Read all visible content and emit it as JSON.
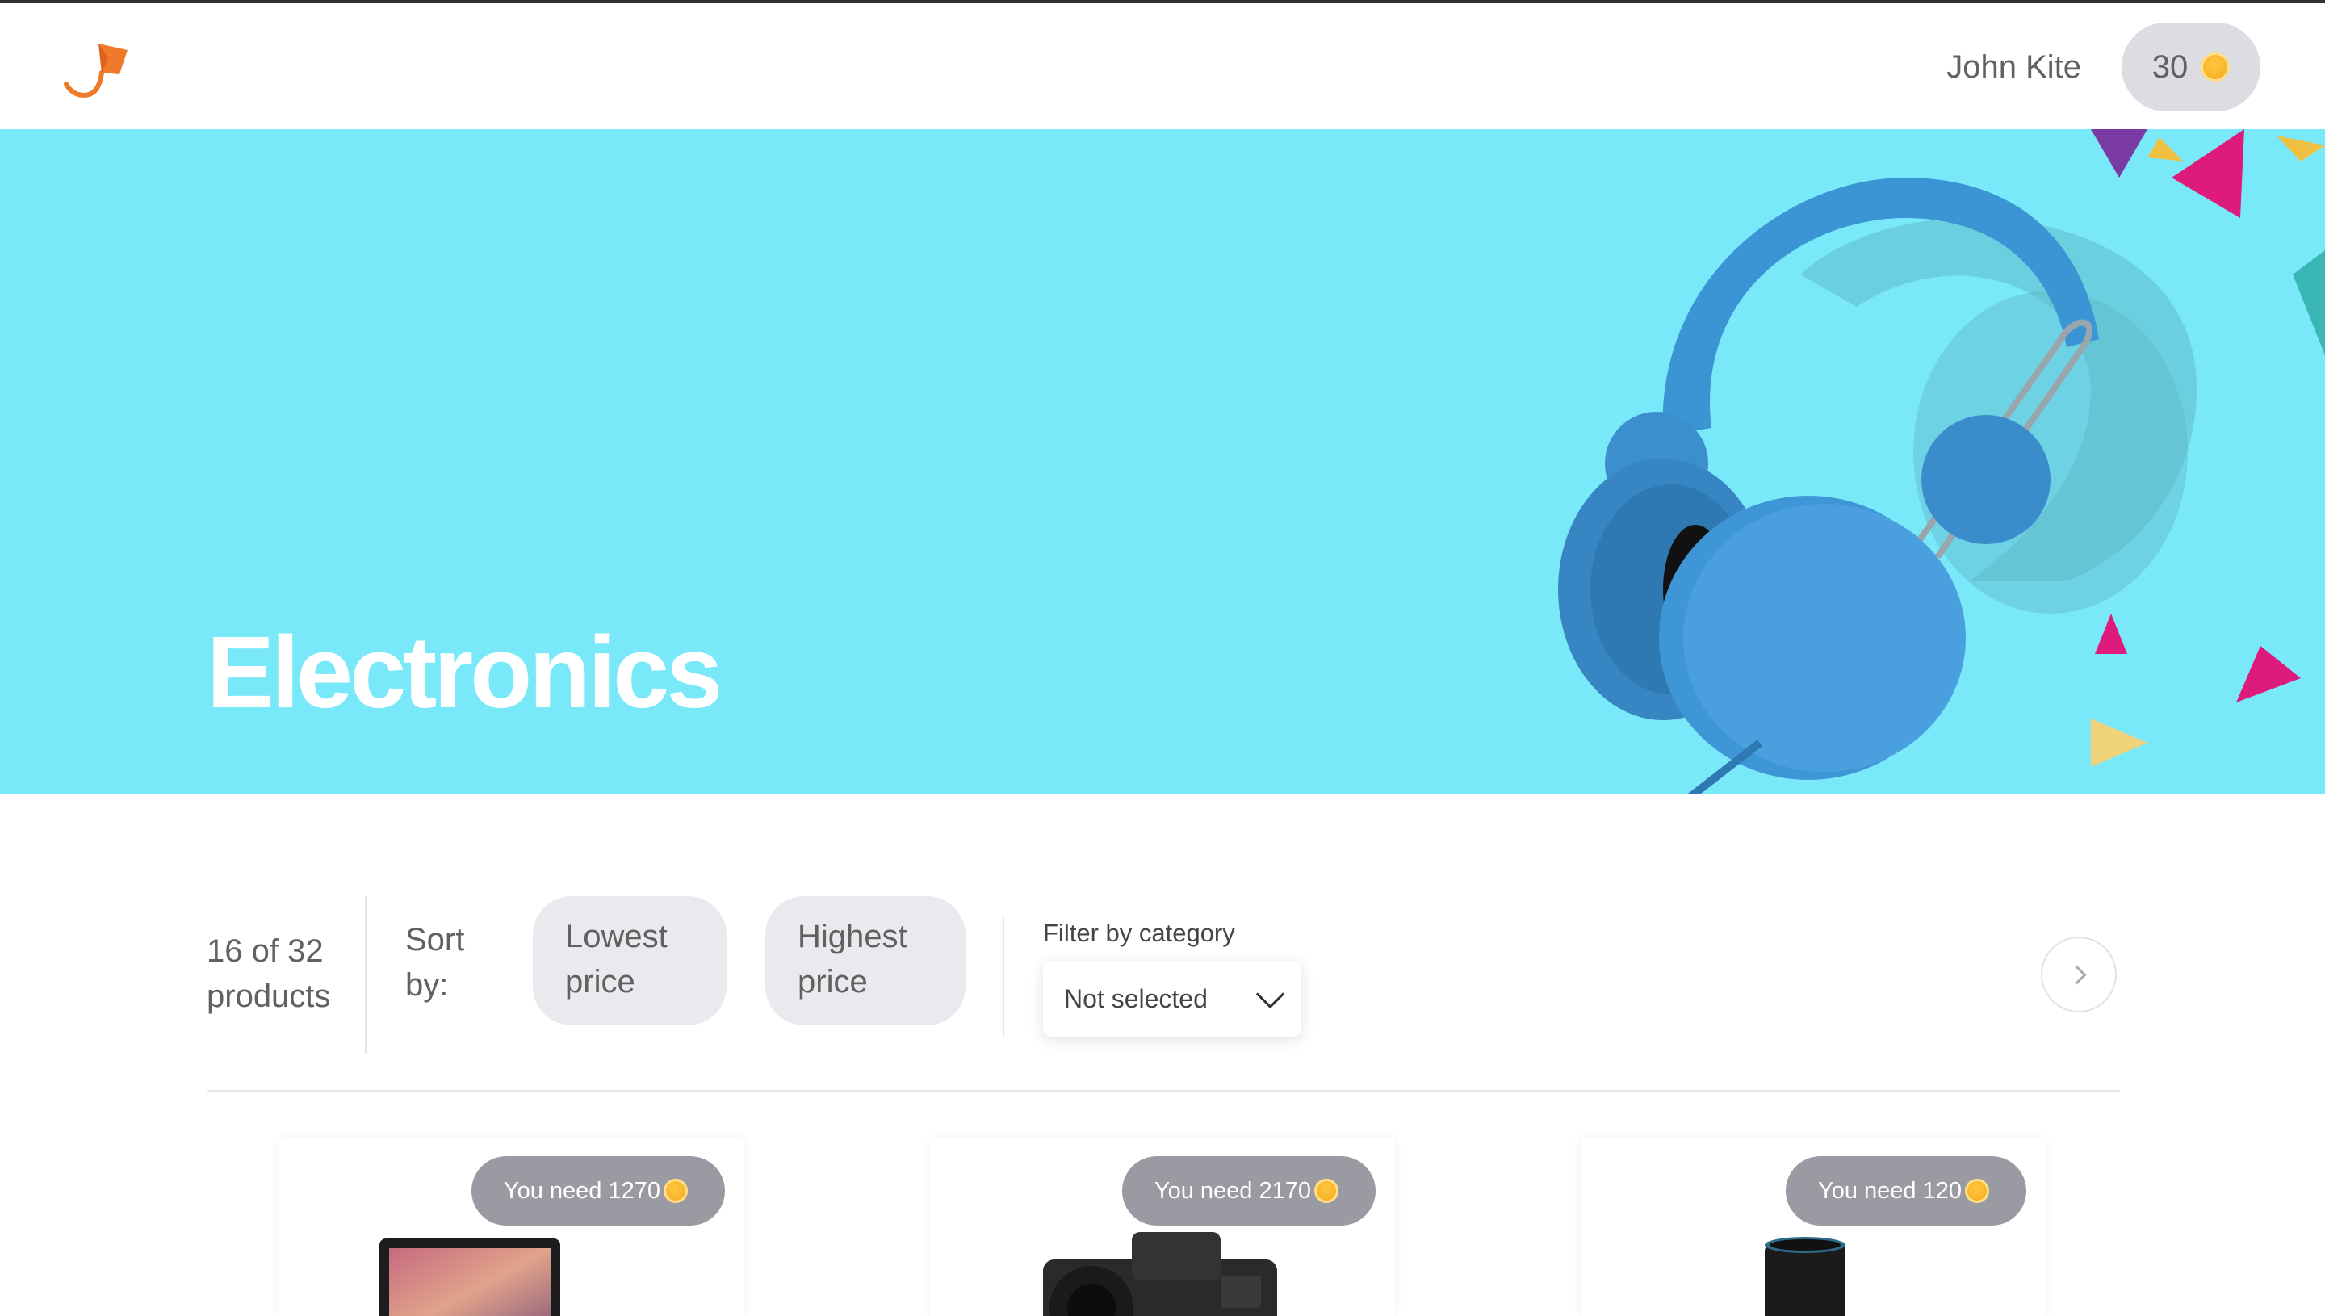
{
  "header": {
    "user_name": "John Kite",
    "points": "30",
    "logo_icon": "kite-logo-icon",
    "coin_icon": "coin-icon"
  },
  "banner": {
    "title": "Electronics",
    "background_color": "#79e9fa",
    "image": "headphones-image"
  },
  "toolbar": {
    "count_text": "16 of 32 products",
    "sort_label": "Sort by:",
    "sort_options": [
      {
        "label": "Lowest price"
      },
      {
        "label": "Highest price"
      }
    ],
    "filter_label": "Filter by category",
    "filter_value": "Not selected",
    "next_icon": "chevron-right-icon"
  },
  "products": [
    {
      "need_text": "You need 1270",
      "image": "laptop-image"
    },
    {
      "need_text": "You need 2170",
      "image": "camera-image"
    },
    {
      "need_text": "You need 120",
      "image": "smart-speaker-image"
    }
  ],
  "colors": {
    "accent": "#f07a2c",
    "coin": "#f7b52b",
    "pill_bg": "#dbdde3",
    "sort_btn_bg": "#e9eaee"
  }
}
